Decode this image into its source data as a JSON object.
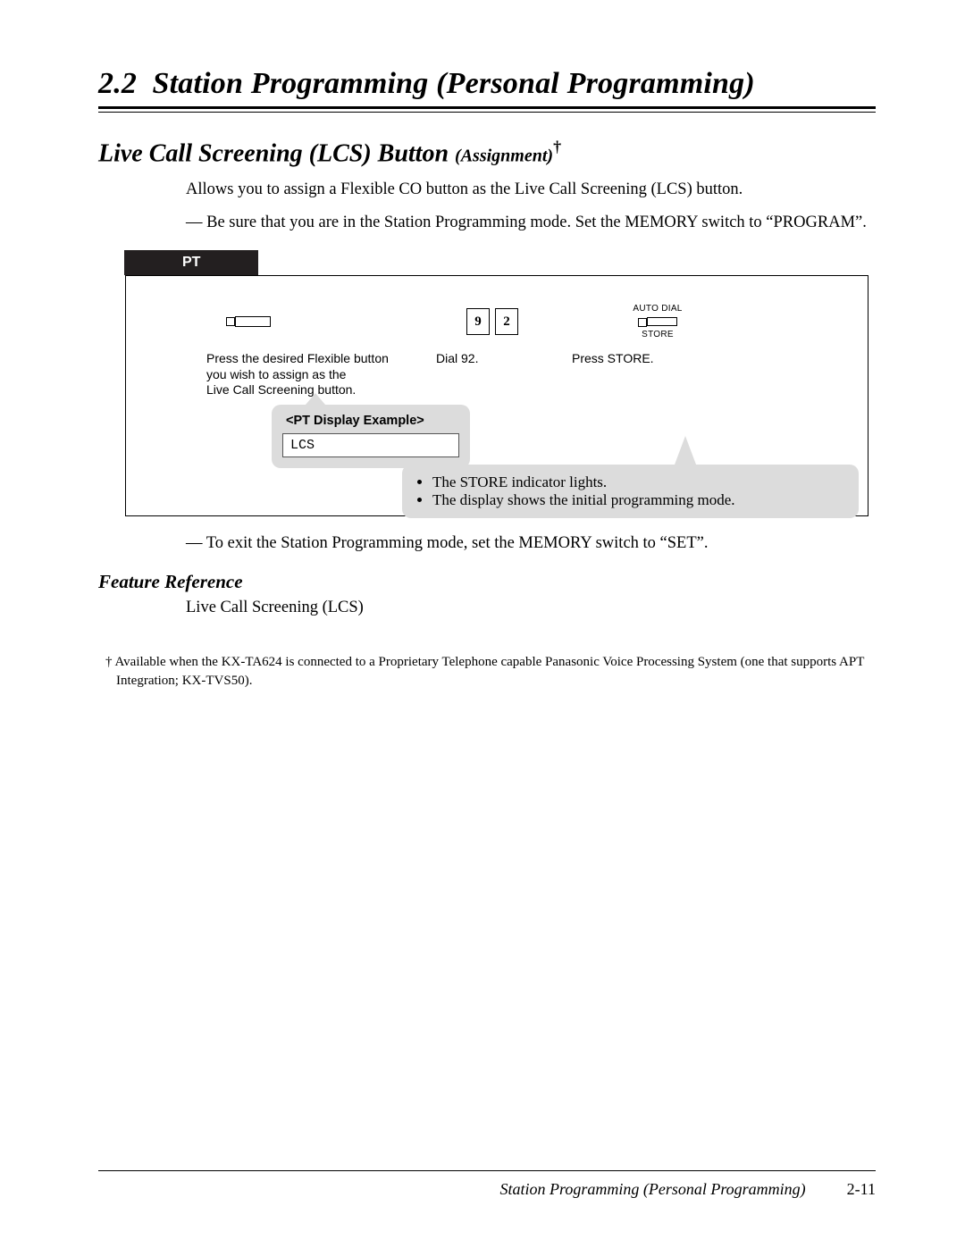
{
  "section": {
    "number": "2.2",
    "title": "Station Programming (Personal Programming)"
  },
  "subsection": {
    "title_main": "Live Call Screening (LCS) Button",
    "title_small": "(Assignment)",
    "dagger": "†"
  },
  "intro": {
    "p1": "Allows you to assign a Flexible CO button as the Live Call Screening (LCS) button.",
    "p2_prefix": "—",
    "p2": "Be sure that you are in the Station Programming mode. Set the MEMORY switch to “PROGRAM”."
  },
  "pt": {
    "tab": "PT",
    "step1_text_l1": "Press the desired Flexible button",
    "step1_text_l2": "you wish to assign as the",
    "step1_text_l3": "Live Call Screening button.",
    "dial_key_1": "9",
    "dial_key_2": "2",
    "step2_text": "Dial 92.",
    "store_top": "AUTO DIAL",
    "store_bottom": "STORE",
    "step3_text": "Press STORE.",
    "display_example_title": "<PT Display Example>",
    "display_example_value": "LCS",
    "note1": "The STORE indicator lights.",
    "note2": "The display shows the initial programming mode."
  },
  "after": {
    "p_prefix": "—",
    "p": "To exit the Station Programming mode, set the MEMORY switch to “SET”."
  },
  "feature_ref": {
    "title": "Feature Reference",
    "item": "Live Call Screening (LCS)"
  },
  "footnote": {
    "mark": "†",
    "text": "Available when the KX-TA624 is connected to a Proprietary Telephone capable Panasonic Voice Processing System (one that supports APT Integration; KX-TVS50)."
  },
  "footer": {
    "title": "Station Programming (Personal Programming)",
    "page": "2-11"
  }
}
